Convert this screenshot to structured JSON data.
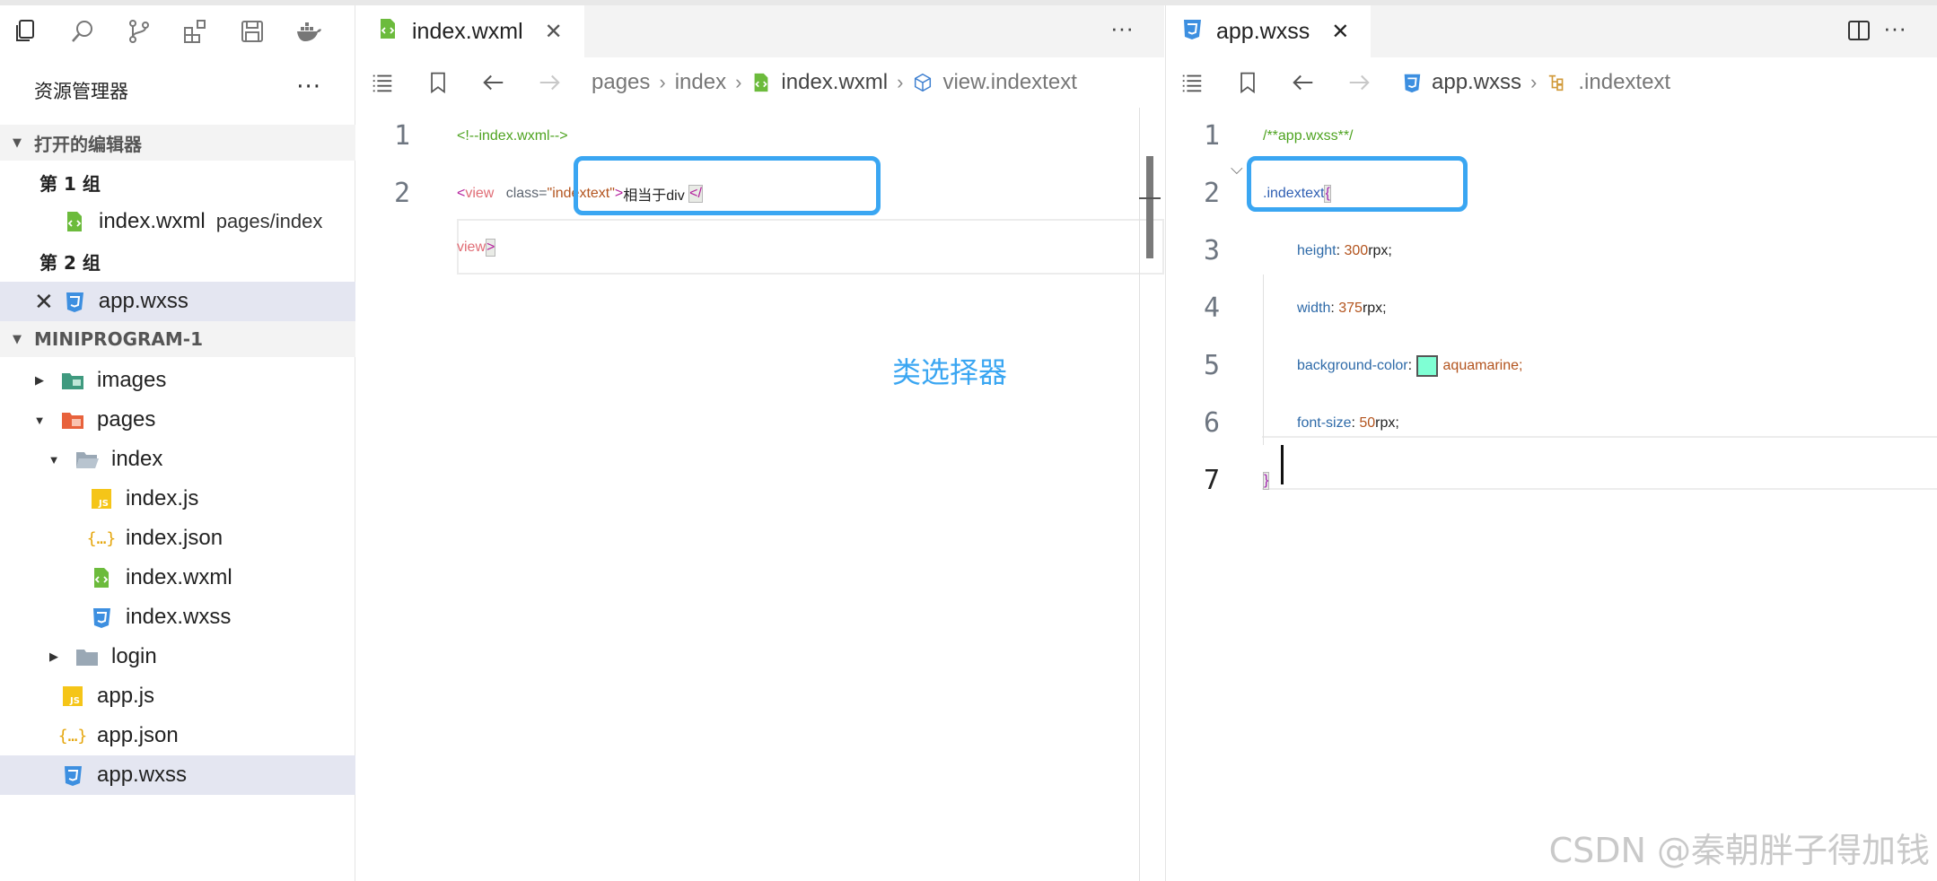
{
  "activity_bar": {
    "icons": [
      "explorer-icon",
      "search-icon",
      "source-control-icon",
      "extensions-icon",
      "save-icon",
      "docker-icon"
    ]
  },
  "explorer": {
    "title": "资源管理器",
    "more": "···",
    "open_editors": {
      "title": "打开的编辑器",
      "group1_label": "第 1 组",
      "group1_file": "index.wxml",
      "group1_desc": "pages/index",
      "group2_label": "第 2 组",
      "group2_file": "app.wxss"
    },
    "project": {
      "title": "MINIPROGRAM-1",
      "items": [
        {
          "label": "images"
        },
        {
          "label": "pages"
        },
        {
          "label": "index"
        },
        {
          "label": "index.js"
        },
        {
          "label": "index.json"
        },
        {
          "label": "index.wxml"
        },
        {
          "label": "index.wxss"
        },
        {
          "label": "login"
        },
        {
          "label": "app.js"
        },
        {
          "label": "app.json"
        },
        {
          "label": "app.wxss"
        }
      ]
    }
  },
  "editor1": {
    "tab_label": "index.wxml",
    "more": "···",
    "breadcrumb": [
      "pages",
      "index",
      "index.wxml",
      "view.indextext"
    ],
    "lines": {
      "n1": "1",
      "n2": "2",
      "l1": "<!--index.wxml-->",
      "l2_open": "<",
      "l2_tag": "view",
      "l2_attr": "class=",
      "l2_q1": "\"",
      "l2_val": "indextext",
      "l2_q2": "\"",
      "l2_close": ">",
      "l2_text": "相当于div ",
      "l2_end": "</",
      "l3_tag": "view",
      "l3_close": ">"
    },
    "annotation": "类选择器"
  },
  "editor2": {
    "tab_label": "app.wxss",
    "more": "···",
    "breadcrumb": [
      "app.wxss",
      ".indextext"
    ],
    "lines": {
      "n1": "1",
      "n2": "2",
      "n3": "3",
      "n4": "4",
      "n5": "5",
      "n6": "6",
      "n7": "7",
      "l1": "/**app.wxss**/",
      "l2_sel": ".indextext",
      "l2_brace": "{",
      "l3_prop": "height",
      "l3_num": "300",
      "l3_unit": "rpx;",
      "l4_prop": "width",
      "l4_num": "375",
      "l4_unit": "rpx;",
      "l5_prop": "background-color",
      "l5_val": "aquamarine;",
      "l6_prop": "font-size",
      "l6_num": "50",
      "l6_unit": "rpx;",
      "l7": "}",
      "colon": ": "
    }
  },
  "watermark": "CSDN @秦朝胖子得加钱",
  "colors": {
    "highlight": "#3aa6f2",
    "swatch": "#7fffd4",
    "selection": "#e4e6f1"
  }
}
